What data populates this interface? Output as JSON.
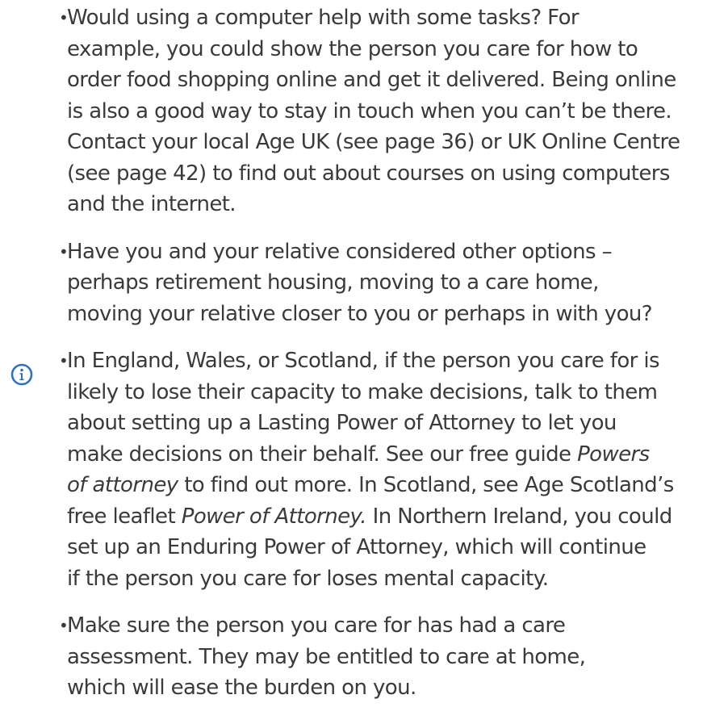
{
  "icons": {
    "info": "info-icon",
    "info_color": "#2f6fc8"
  },
  "bullets": [
    {
      "lines": [
        "Would using a computer help with some tasks? For",
        "example, you could show the person you care for how to",
        "order food shopping online and get it delivered. Being online",
        "is also a good way to stay in touch when you can’t be there.",
        "Contact your local Age UK (see page 36) or UK Online Centre",
        "(see page 42) to find out about courses on using computers",
        "and the internet."
      ]
    },
    {
      "lines": [
        "Have you and your relative considered other options –",
        "perhaps retirement housing, moving to a care home,",
        "moving your relative closer to you or perhaps in with you?"
      ]
    },
    {
      "lines": [
        "In England, Wales, or Scotland, if the person you care for is",
        "likely to lose their capacity to make decisions, talk to them",
        "about setting up a Lasting Power of Attorney to let you",
        "make decisions on their behalf. See our free guide",
        "Powers",
        "of attorney",
        "to find out more. In Scotland, see Age Scotland’s",
        "free leaflet",
        "Power of Attorney.",
        "In Northern Ireland, you could",
        "set up an Enduring Power of Attorney, which will continue",
        "if the person you care for loses mental capacity."
      ]
    },
    {
      "lines": [
        "Make sure the person you care for has had a care",
        "assessment. They may be entitled to care at home,",
        "which will ease the burden on you."
      ]
    }
  ]
}
